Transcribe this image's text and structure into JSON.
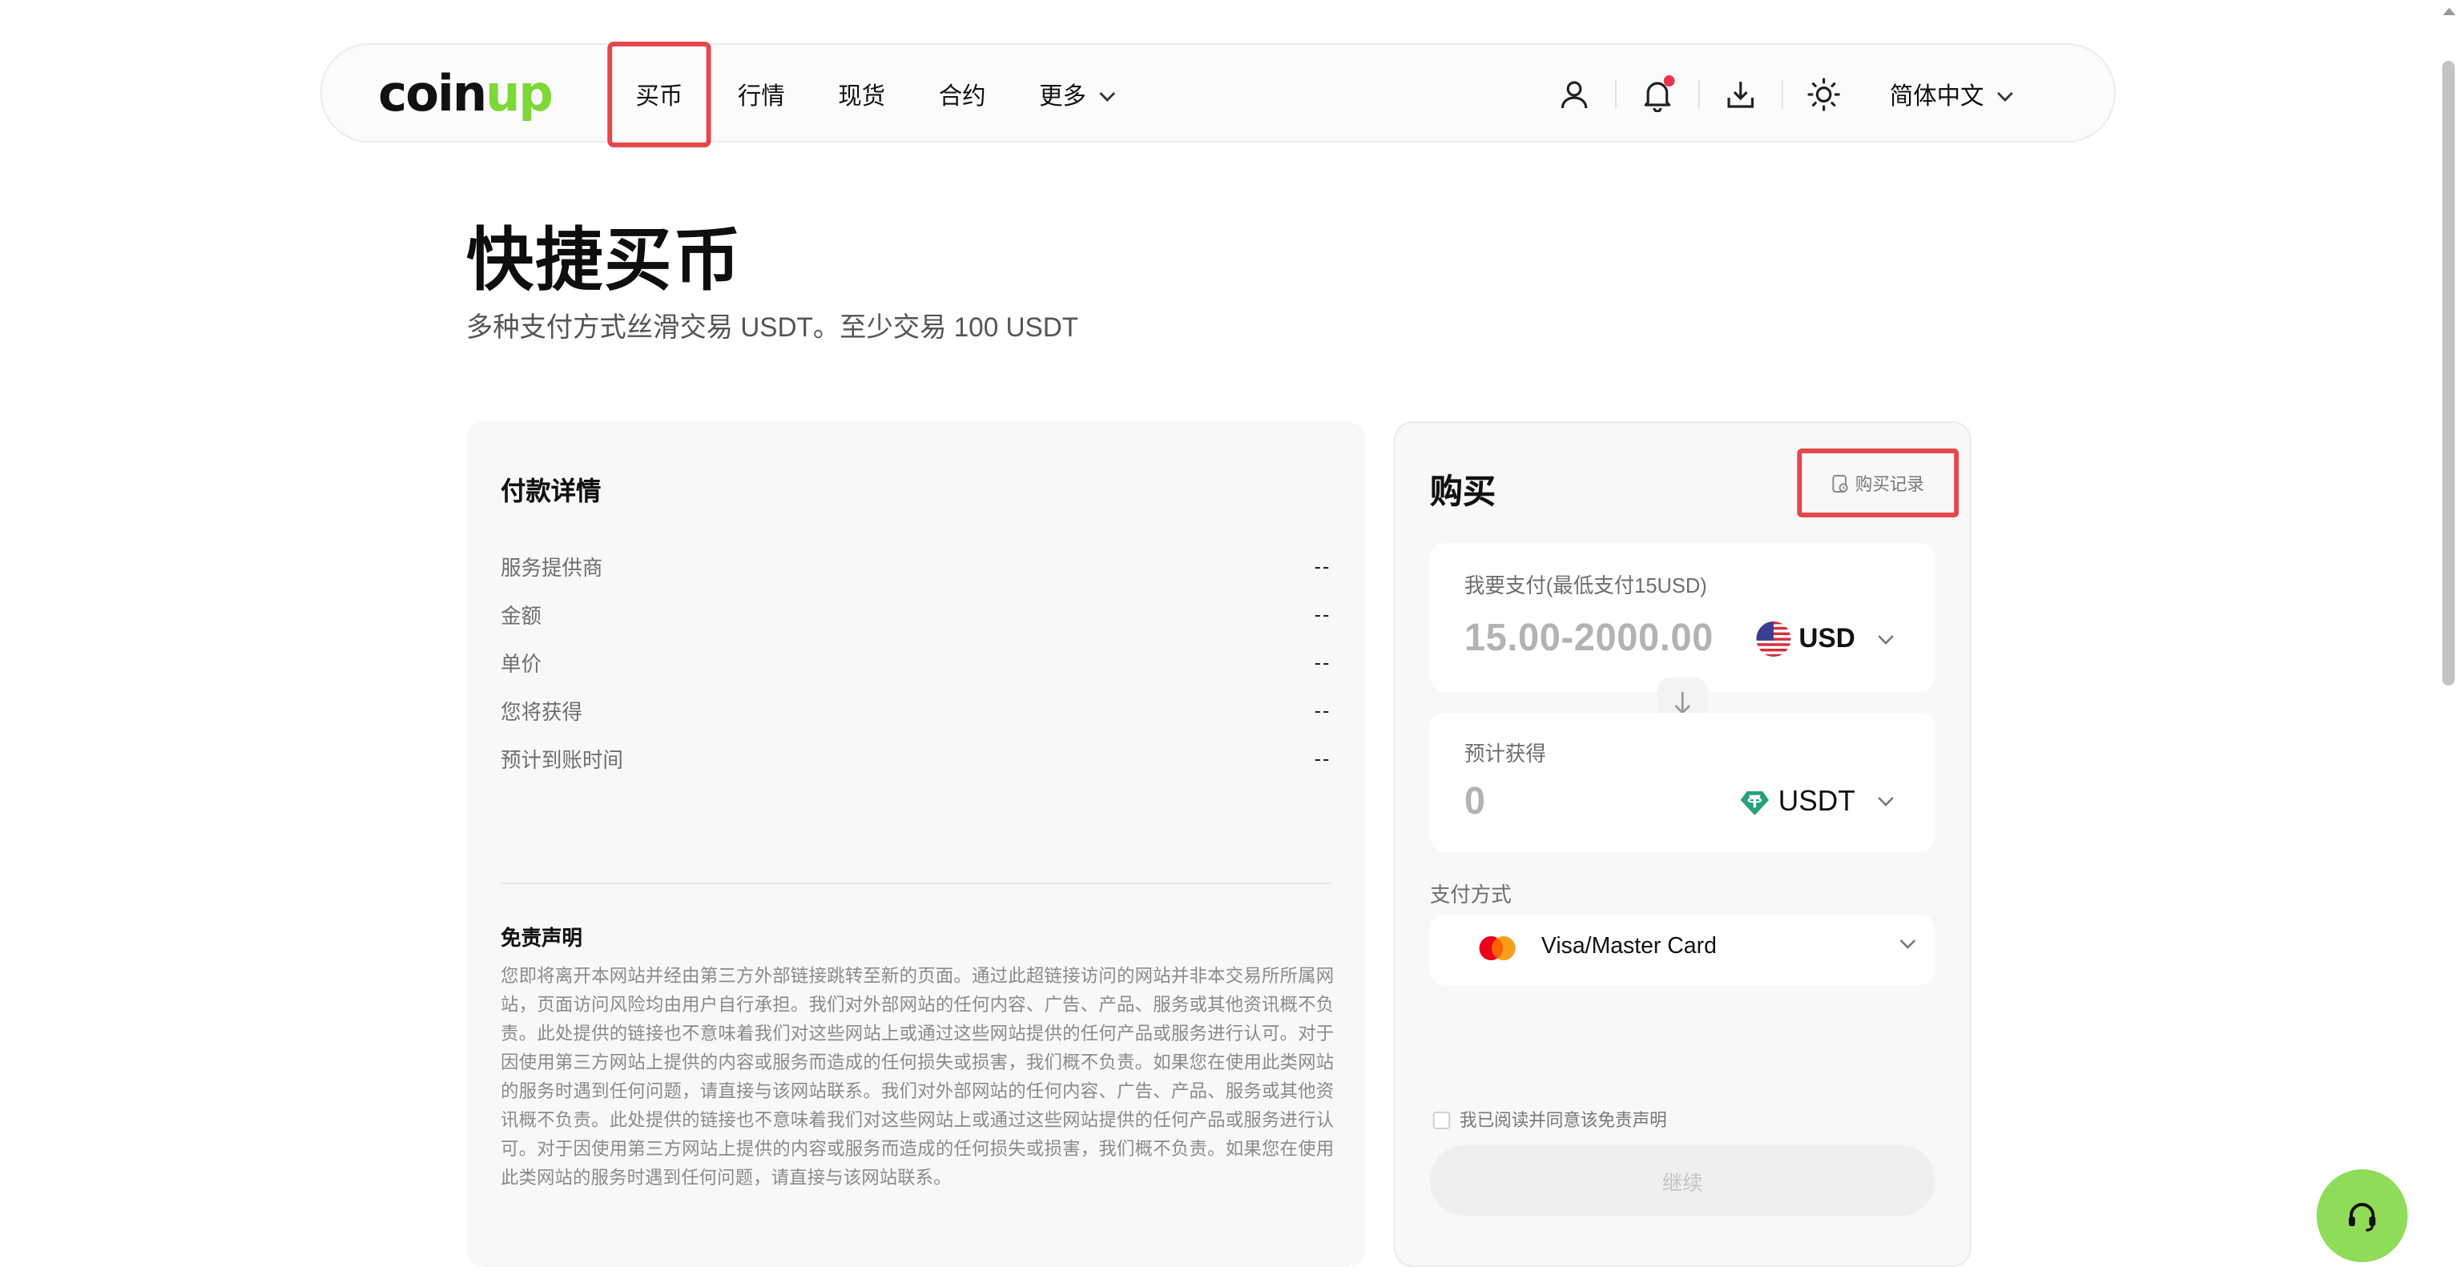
{
  "header": {
    "logo": {
      "part1": "coin",
      "part2": "up"
    },
    "nav": [
      {
        "label": "买币",
        "active": true
      },
      {
        "label": "行情"
      },
      {
        "label": "现货"
      },
      {
        "label": "合约"
      },
      {
        "label": "更多",
        "has_dropdown": true
      }
    ],
    "icons": [
      "user-icon",
      "bell-icon",
      "download-icon",
      "theme-icon"
    ],
    "language": "简体中文"
  },
  "page": {
    "title": "快捷买币",
    "subtitle": "多种支付方式丝滑交易 USDT。至少交易 100 USDT"
  },
  "details": {
    "title": "付款详情",
    "rows": [
      {
        "label": "服务提供商",
        "value": "--"
      },
      {
        "label": "金额",
        "value": "--"
      },
      {
        "label": "单价",
        "value": "--"
      },
      {
        "label": "您将获得",
        "value": "--"
      },
      {
        "label": "预计到账时间",
        "value": "--"
      }
    ],
    "disclaimer_title": "免责声明",
    "disclaimer_text": "您即将离开本网站并经由第三方外部链接跳转至新的页面。通过此超链接访问的网站并非本交易所所属网站，页面访问风险均由用户自行承担。我们对外部网站的任何内容、广告、产品、服务或其他资讯概不负责。此处提供的链接也不意味着我们对这些网站上或通过这些网站提供的任何产品或服务进行认可。对于因使用第三方网站上提供的内容或服务而造成的任何损失或损害，我们概不负责。如果您在使用此类网站的服务时遇到任何问题，请直接与该网站联系。我们对外部网站的任何内容、广告、产品、服务或其他资讯概不负责。此处提供的链接也不意味着我们对这些网站上或通过这些网站提供的任何产品或服务进行认可。对于因使用第三方网站上提供的内容或服务而造成的任何损失或损害，我们概不负责。如果您在使用此类网站的服务时遇到任何问题，请直接与该网站联系。"
  },
  "buy": {
    "title": "购买",
    "history_label": "购买记录",
    "pay": {
      "label": "我要支付(最低支付15USD)",
      "placeholder": "15.00-2000.00",
      "currency": "USD"
    },
    "receive": {
      "label": "预计获得",
      "value": "0",
      "currency": "USDT"
    },
    "payment_method_label": "支付方式",
    "payment_method": "Visa/Master Card",
    "agree_text": "我已阅读并同意该免责声明",
    "continue_label": "继续"
  },
  "colors": {
    "accent_green": "#7dd836",
    "highlight_red": "#e5474c",
    "notification_dot": "#e8364f",
    "tether_green": "#26a17b"
  }
}
